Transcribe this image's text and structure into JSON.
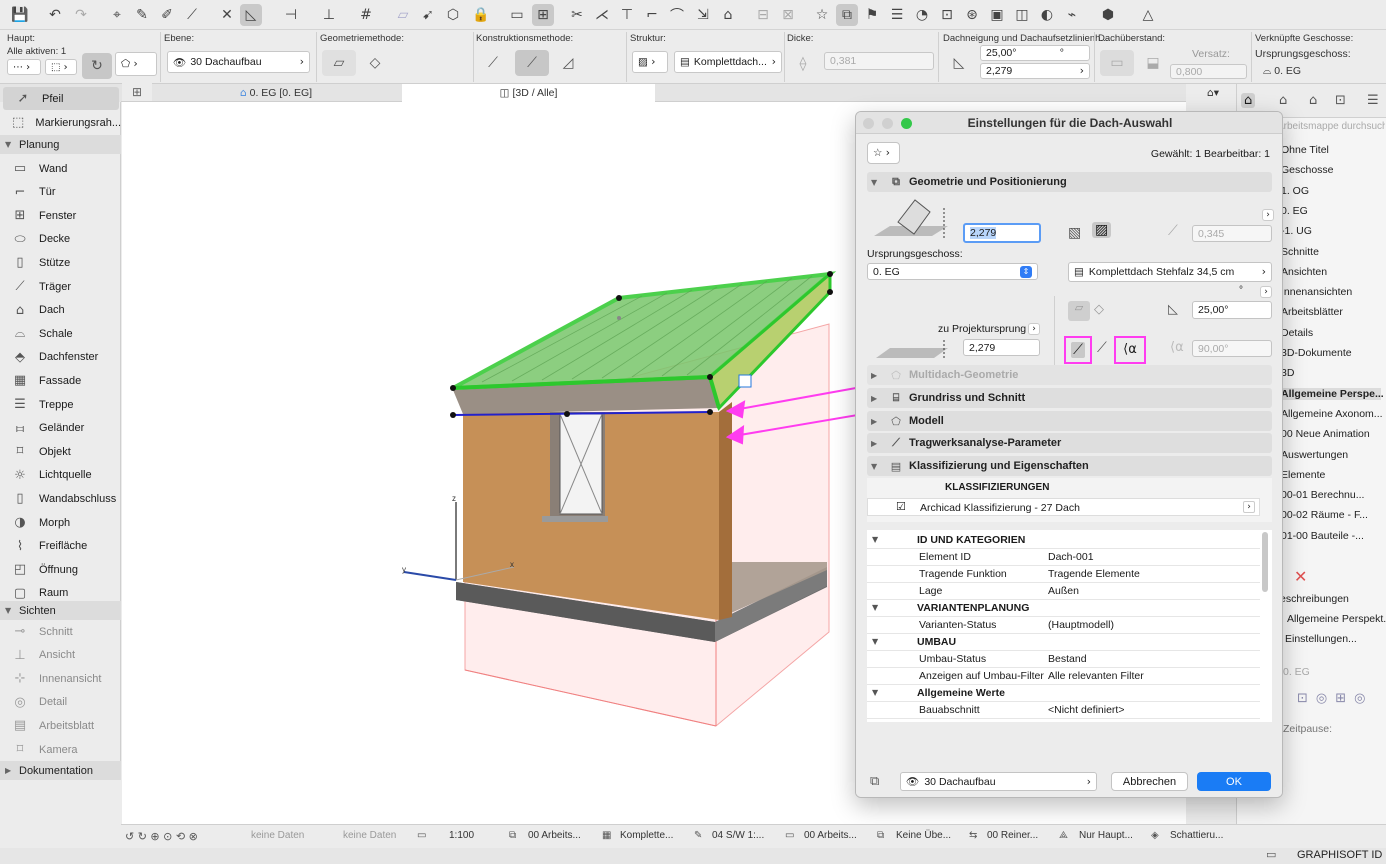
{
  "toolbar": {
    "icons": [
      "save-icon",
      "undo-icon",
      "redo-icon",
      "find-select-icon",
      "eyedropper-icon",
      "inject-icon",
      "magic-wand-icon",
      "suspend-groups-icon",
      "gravity-icon",
      "snap-icon",
      "guideline-icon",
      "grid-snap-icon",
      "layout-icon",
      "arrow-icon",
      "3d-icon",
      "star-icon",
      "markup-icon",
      "flag-icon",
      "image-icon",
      "publish-icon"
    ]
  },
  "infobox": {
    "haupt_label": "Haupt:",
    "all_active": "Alle aktiven: 1",
    "ebene_label": "Ebene:",
    "ebene_value": "30 Dachaufbau",
    "geometrie_label": "Geometriemethode:",
    "konstruktion_label": "Konstruktionsmethode:",
    "struktur_label": "Struktur:",
    "struktur_value": "Komplettdach...",
    "dicke_label": "Dicke:",
    "dicke_value": "0,381",
    "dachneigung_label": "Dachneigung und Dachaufsetzlinienh...",
    "dachneigung_value": "25,00°",
    "dachneigung_unit": "°",
    "hoehe_value": "2,279",
    "dachueberstand_label": "Dachüberstand:",
    "versatz_label": "Versatz:",
    "versatz_value": "0,800",
    "verknuepfte_label": "Verknüpfte Geschosse:",
    "ursprung_label": "Ursprungsgeschoss:",
    "ursprung_value": "0. EG"
  },
  "tabs": [
    {
      "label": "0. EG [0. EG]"
    },
    {
      "label": "[3D / Alle]"
    }
  ],
  "toolbox": {
    "tools_top": [
      {
        "label": "Pfeil",
        "icon": "arrow-icon"
      },
      {
        "label": "Markierungsrah...",
        "icon": "marquee-icon"
      }
    ],
    "groups": [
      {
        "label": "Planung"
      },
      {
        "label": "Sichten"
      },
      {
        "label": "Dokumentation"
      }
    ],
    "planung": [
      {
        "label": "Wand",
        "icon": "wall-icon"
      },
      {
        "label": "Tür",
        "icon": "door-icon"
      },
      {
        "label": "Fenster",
        "icon": "window-icon"
      },
      {
        "label": "Decke",
        "icon": "slab-icon"
      },
      {
        "label": "Stütze",
        "icon": "column-icon"
      },
      {
        "label": "Träger",
        "icon": "beam-icon"
      },
      {
        "label": "Dach",
        "icon": "roof-icon"
      },
      {
        "label": "Schale",
        "icon": "shell-icon"
      },
      {
        "label": "Dachfenster",
        "icon": "skylight-icon"
      },
      {
        "label": "Fassade",
        "icon": "curtain-wall-icon"
      },
      {
        "label": "Treppe",
        "icon": "stair-icon"
      },
      {
        "label": "Geländer",
        "icon": "railing-icon"
      },
      {
        "label": "Objekt",
        "icon": "object-icon"
      },
      {
        "label": "Lichtquelle",
        "icon": "lamp-icon"
      },
      {
        "label": "Wandabschluss",
        "icon": "wall-end-icon"
      },
      {
        "label": "Morph",
        "icon": "morph-icon"
      },
      {
        "label": "Freifläche",
        "icon": "mesh-icon"
      },
      {
        "label": "Öffnung",
        "icon": "opening-icon"
      },
      {
        "label": "Raum",
        "icon": "zone-icon"
      }
    ],
    "sichten": [
      {
        "label": "Schnitt",
        "icon": "section-icon"
      },
      {
        "label": "Ansicht",
        "icon": "elevation-icon"
      },
      {
        "label": "Innenansicht",
        "icon": "interior-elevation-icon"
      },
      {
        "label": "Detail",
        "icon": "detail-icon"
      },
      {
        "label": "Arbeitsblatt",
        "icon": "worksheet-icon"
      },
      {
        "label": "Kamera",
        "icon": "camera-icon"
      }
    ]
  },
  "navigator": {
    "search_placeholder": "Arbeitsmappe durchsuchen",
    "items": [
      "Ohne Titel",
      "Geschosse",
      "1. OG",
      "0. EG",
      "-1. UG",
      "Schnitte",
      "Ansichten",
      "Innenansichten",
      "Arbeitsblätter",
      "Details",
      "3D-Dokumente",
      "3D",
      "Allgemeine Perspe...",
      "Allgemeine Axonom...",
      "00 Neue Animation",
      "Auswertungen",
      "Elemente",
      "00-01 Berechnu...",
      "00-02 Räume - F...",
      "01-00 Bauteile -..."
    ],
    "beschreibungen": "Beschreibungen",
    "view_name": "Allgemeine Perspekt...",
    "settings": "Einstellungen...",
    "floor": "0. EG",
    "pause": "Zeitpause:"
  },
  "dialog": {
    "title": "Einstellungen für die Dach-Auswahl",
    "selected_info": "Gewählt: 1 Bearbeitbar: 1",
    "sections": {
      "geometrie": "Geometrie und Positionierung",
      "multidach": "Multidach-Geometrie",
      "grundriss": "Grundriss und Schnitt",
      "modell": "Modell",
      "tragwerk": "Tragwerksanalyse-Parameter",
      "klassifizierung": "Klassifizierung und Eigenschaften"
    },
    "height_value": "2,279",
    "thickness_value": "0,345",
    "ursprung_label": "Ursprungsgeschoss:",
    "ursprung_value": "0. EG",
    "structure_value": "Komplettdach Stehfalz 34,5 cm",
    "degree_unit": "°",
    "pitch_value": "25,00°",
    "projekt_label": "zu Projektursprung",
    "projekt_value": "2,279",
    "angle2_value": "90,00°",
    "klass_header": "KLASSIFIZIERUNGEN",
    "klass_value": "Archicad Klassifizierung - 27 Dach",
    "props": [
      {
        "type": "group",
        "name": "ID UND KATEGORIEN"
      },
      {
        "type": "row",
        "name": "Element ID",
        "value": "Dach-001"
      },
      {
        "type": "row",
        "name": "Tragende Funktion",
        "value": "Tragende Elemente"
      },
      {
        "type": "row",
        "name": "Lage",
        "value": "Außen"
      },
      {
        "type": "group",
        "name": "VARIANTENPLANUNG"
      },
      {
        "type": "row",
        "name": "Varianten-Status",
        "value": "(Hauptmodell)"
      },
      {
        "type": "group",
        "name": "UMBAU"
      },
      {
        "type": "row",
        "name": "Umbau-Status",
        "value": "Bestand"
      },
      {
        "type": "row",
        "name": "Anzeigen auf Umbau-Filter",
        "value": "Alle relevanten Filter"
      },
      {
        "type": "group",
        "name": "Allgemeine Werte"
      },
      {
        "type": "row",
        "name": "Bauabschnitt",
        "value": "<Nicht definiert>"
      }
    ],
    "layer_value": "30 Dachaufbau",
    "cancel": "Abbrechen",
    "ok": "OK"
  },
  "statusbar": [
    "keine Daten",
    "keine Daten",
    "1:100",
    "00 Arbeits...",
    "Komplette...",
    "04 S/W 1:...",
    "00 Arbeits...",
    "Keine Übe...",
    "00 Reiner...",
    "Nur Haupt...",
    "Schattieru..."
  ],
  "footer": {
    "brand": "GRAPHISOFT ID"
  },
  "colors": {
    "accent": "#1a7cf5",
    "magenta": "#ff3cf0",
    "roof_green": "#3ecf2a",
    "wall": "#c8935a"
  }
}
